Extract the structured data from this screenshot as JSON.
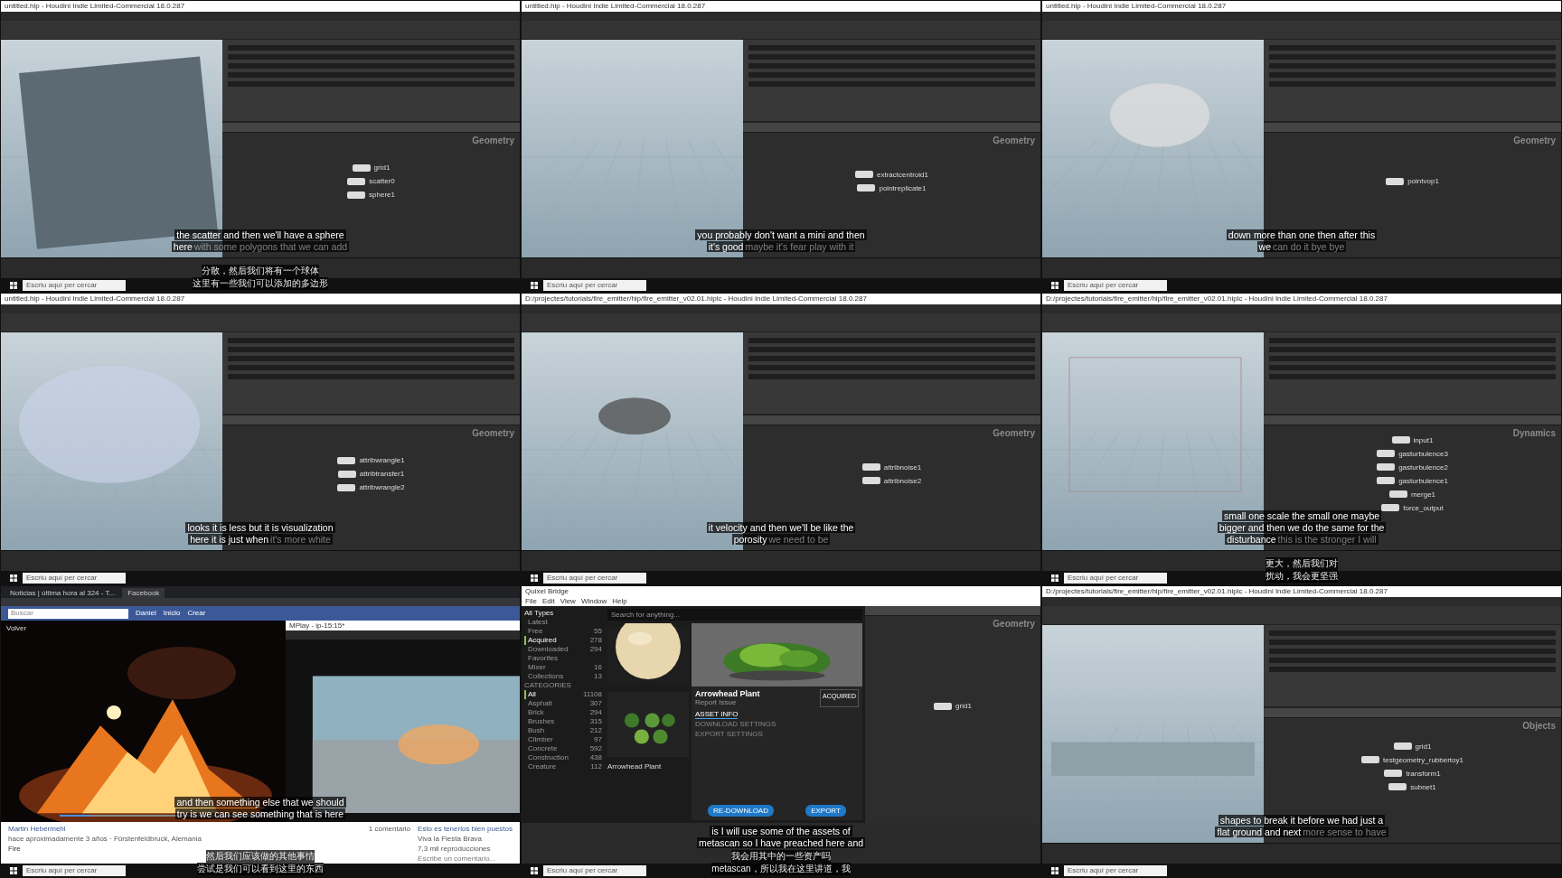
{
  "panels": [
    {
      "kind": "houdini",
      "title": "untitled.hip - Houdini Indie Limited-Commercial 18.0.287",
      "viewport": {
        "kind": "plane"
      },
      "context": "Geometry",
      "nodes": [
        "grid1",
        "scatter0",
        "sphere1"
      ],
      "subtitles": [
        {
          "text": "the scatter and then we'll have a sphere"
        },
        {
          "text": "here",
          "faded": "with some polygons that we can add"
        }
      ],
      "cn": [
        "分散，然后我们将有一个球体",
        "这里有一些我们可以添加的多边形"
      ],
      "taskbar_search": "Escriu aquí per cercar"
    },
    {
      "kind": "houdini",
      "title": "untitled.hip - Houdini Indie Limited-Commercial 18.0.287",
      "viewport": {
        "kind": "floor"
      },
      "context": "Geometry",
      "nodes": [
        "extractcentroid1",
        "pointreplicate1"
      ],
      "subtitles": [
        {
          "text": "you probably don't want a mini and then"
        },
        {
          "text": "it's good",
          "faded": "maybe it's fear play with it"
        }
      ],
      "taskbar_search": "Escriu aquí per cercar"
    },
    {
      "kind": "houdini",
      "title": "untitled.hip - Houdini Indie Limited-Commercial 18.0.287",
      "viewport": {
        "kind": "cloud"
      },
      "context": "Geometry",
      "nodes": [
        "pointvop1"
      ],
      "subtitles": [
        {
          "text": "down more than one then after this"
        },
        {
          "text": "we",
          "faded": "can do it bye bye"
        }
      ],
      "taskbar_search": "Escriu aquí per cercar"
    },
    {
      "kind": "houdini",
      "title": "untitled.hip - Houdini Indie Limited-Commercial 18.0.287",
      "viewport": {
        "kind": "points"
      },
      "context": "Geometry",
      "nodes": [
        "attribwrangle1",
        "attribtransfer1",
        "attribwrangle2"
      ],
      "subtitles": [
        {
          "text": "looks it is less but it is visualization"
        },
        {
          "text": "here it is just when",
          "faded": "it's more white"
        }
      ],
      "taskbar_search": "Escriu aquí per cercar"
    },
    {
      "kind": "houdini",
      "title": "D:/projectes/tutorials/fire_emitter/hip/fire_emitter_v02.01.hiplc - Houdini Indie Limited-Commercial 18.0.287",
      "viewport": {
        "kind": "smoke"
      },
      "context": "Geometry",
      "nodes": [
        "attribnoise1",
        "attribnoise2"
      ],
      "subtitles": [
        {
          "text": "it velocity and then we'll be like the"
        },
        {
          "text": "porosity",
          "faded": "we need to be"
        }
      ],
      "taskbar_search": "Escriu aquí per cercar"
    },
    {
      "kind": "houdini",
      "title": "D:/projectes/tutorials/fire_emitter/hip/fire_emitter_v02.01.hiplc - Houdini Indie Limited-Commercial 18.0.287",
      "viewport": {
        "kind": "box"
      },
      "context": "Dynamics",
      "nodes": [
        "input1",
        "gasturbulence3",
        "gasturbulence2",
        "gasturbulence1",
        "merge1",
        "force_output"
      ],
      "subtitles": [
        {
          "text": "small one scale the small one maybe"
        },
        {
          "text": "bigger and then we do the same for the"
        },
        {
          "text": "disturbance",
          "faded": "this is the stronger I will"
        }
      ],
      "cn": [
        "更大，然后我们对",
        "扰动，我会更坚强"
      ],
      "taskbar_search": "Escriu aquí per cercar"
    },
    {
      "kind": "browser",
      "tabs": [
        {
          "label": "Noticias | última hora al 324 - T...",
          "selected": false
        },
        {
          "label": "Facebook",
          "selected": true
        }
      ],
      "search": {
        "placeholder": "Buscar"
      },
      "nav": [
        "Daniel",
        "Inicio",
        "Crear"
      ],
      "back": "Volver",
      "player_title": "MPlay - ip-15:15*",
      "author": "Martin Hebermehl",
      "meta": "hace aproximadamente 3 años · Fürstenfeldbruck, Alemania",
      "post": "Fire",
      "comments": "1 comentario",
      "related": {
        "title": "Esto es tenerlos bien puestos",
        "source": "Viva la Fiesta Brava",
        "views": "7,3 mil reproducciones"
      },
      "comment": {
        "placeholder": "Escribe un comentario..."
      },
      "video": {
        "level": 0.14
      },
      "subtitles": [
        {
          "text": "and then something else that we should"
        },
        {
          "text": "try is we can see something that is here"
        }
      ],
      "cn": [
        "然后我们应该做的其他事情",
        "尝试是我们可以看到这里的东西"
      ],
      "taskbar_search": "Escriu aquí per cercar"
    },
    {
      "kind": "bridge",
      "window_title": "Quixel Bridge",
      "menu": [
        "File",
        "Edit",
        "View",
        "Window",
        "Help"
      ],
      "filter": "All Types",
      "search": {
        "placeholder": "Search for anything..."
      },
      "sidebar": [
        {
          "label": "Latest",
          "selected": false
        },
        {
          "label": "Free",
          "count": "55",
          "selected": false
        },
        {
          "label": "Acquired",
          "count": "278",
          "selected": true
        },
        {
          "label": "Downloaded",
          "count": "294",
          "selected": false
        },
        {
          "label": "Favorites",
          "selected": false
        },
        {
          "label": "Mixer",
          "count": "16",
          "selected": false
        },
        {
          "label": "Collections",
          "count": "13",
          "selected": false
        }
      ],
      "categories_title": "CATEGORIES",
      "categories": [
        {
          "label": "All",
          "count": "11108",
          "selected": true
        },
        {
          "label": "Asphalt",
          "count": "307",
          "selected": false
        },
        {
          "label": "Brick",
          "count": "294",
          "selected": false
        },
        {
          "label": "Brushes",
          "count": "315",
          "selected": false
        },
        {
          "label": "Bush",
          "count": "212",
          "selected": false
        },
        {
          "label": "Climber",
          "count": "97",
          "selected": false
        },
        {
          "label": "Concrete",
          "count": "592",
          "selected": false
        },
        {
          "label": "Construction",
          "count": "438",
          "selected": false
        },
        {
          "label": "Creature",
          "count": "112",
          "selected": false
        }
      ],
      "thumb_caption": "Arrowhead Plant",
      "asset": {
        "name": "Arrowhead Plant",
        "report": "Report Issue",
        "badge": "ACQUIRED"
      },
      "asset_tabs": [
        {
          "label": "ASSET INFO",
          "selected": true
        },
        {
          "label": "DOWNLOAD SETTINGS",
          "selected": false
        },
        {
          "label": "EXPORT SETTINGS",
          "selected": false
        }
      ],
      "buttons": [
        "RE-DOWNLOAD",
        "EXPORT"
      ],
      "context": "Geometry",
      "nodes": [
        "grid1"
      ],
      "subtitles": [
        {
          "text": "is I will use some of the assets of"
        },
        {
          "text": "metascan so I have preached here and"
        }
      ],
      "cn": [
        "我会用其中的一些资产吗",
        "metascan，所以我在这里讲道，我"
      ],
      "taskbar_search": "Escriu aquí per cercar"
    },
    {
      "kind": "houdini",
      "title": "D:/projectes/tutorials/fire_emitter/hip/fire_emitter_v02.01.hiplc - Houdini Indie Limited-Commercial 18.0.287",
      "viewport": {
        "kind": "flat"
      },
      "context": "Objects",
      "nodes": [
        "grid1",
        "testgeometry_rubbertoy1",
        "transform1",
        "subnet1"
      ],
      "subtitles": [
        {
          "text": "shapes to break it before we had just a"
        },
        {
          "text": "flat ground and next",
          "faded": "more sense to have"
        }
      ],
      "taskbar_search": "Escriu aquí per cercar"
    }
  ]
}
